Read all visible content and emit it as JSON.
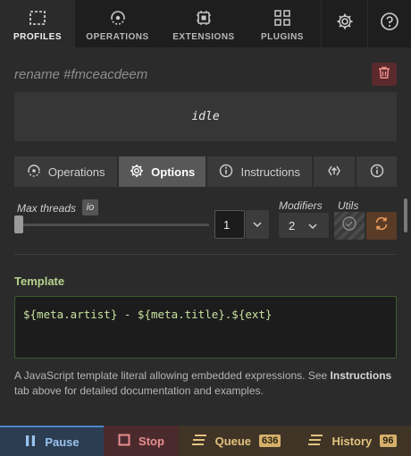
{
  "nav": {
    "tabs": [
      {
        "label": "PROFILES",
        "icon": "profiles-icon"
      },
      {
        "label": "OPERATIONS",
        "icon": "operations-icon"
      },
      {
        "label": "EXTENSIONS",
        "icon": "extensions-icon"
      },
      {
        "label": "PLUGINS",
        "icon": "plugins-icon"
      }
    ],
    "active": "PROFILES",
    "settings_icon": "gear-icon",
    "help_icon": "help-icon"
  },
  "profile": {
    "name": "rename #fmceacdeem",
    "status": "idle"
  },
  "subtabs": [
    {
      "label": "Operations",
      "icon": "operations-icon"
    },
    {
      "label": "Options",
      "icon": "gear-icon"
    },
    {
      "label": "Instructions",
      "icon": "info-icon"
    },
    {
      "label": "",
      "icon": "upload-icon"
    },
    {
      "label": "",
      "icon": "info-icon"
    }
  ],
  "options": {
    "max_threads_label": "Max threads",
    "io_badge": "io",
    "max_threads_value": "1",
    "modifiers_label": "Modifiers",
    "modifiers_value": "2",
    "utils_label": "Utils"
  },
  "template": {
    "title": "Template",
    "value": "${meta.artist} - ${meta.title}.${ext}",
    "help_prefix": "A JavaScript template literal allowing embedded expressions. See ",
    "help_bold": "Instructions",
    "help_suffix": " tab above for detailed documentation and examples."
  },
  "bottom": {
    "pause": "Pause",
    "stop": "Stop",
    "queue": "Queue",
    "queue_count": "636",
    "history": "History",
    "history_count": "96"
  },
  "colors": {
    "accent_green": "#b7d38d",
    "pause_blue": "#9cc4ee",
    "stop_red": "#e98f8f",
    "queue_amber": "#e3c27f"
  }
}
